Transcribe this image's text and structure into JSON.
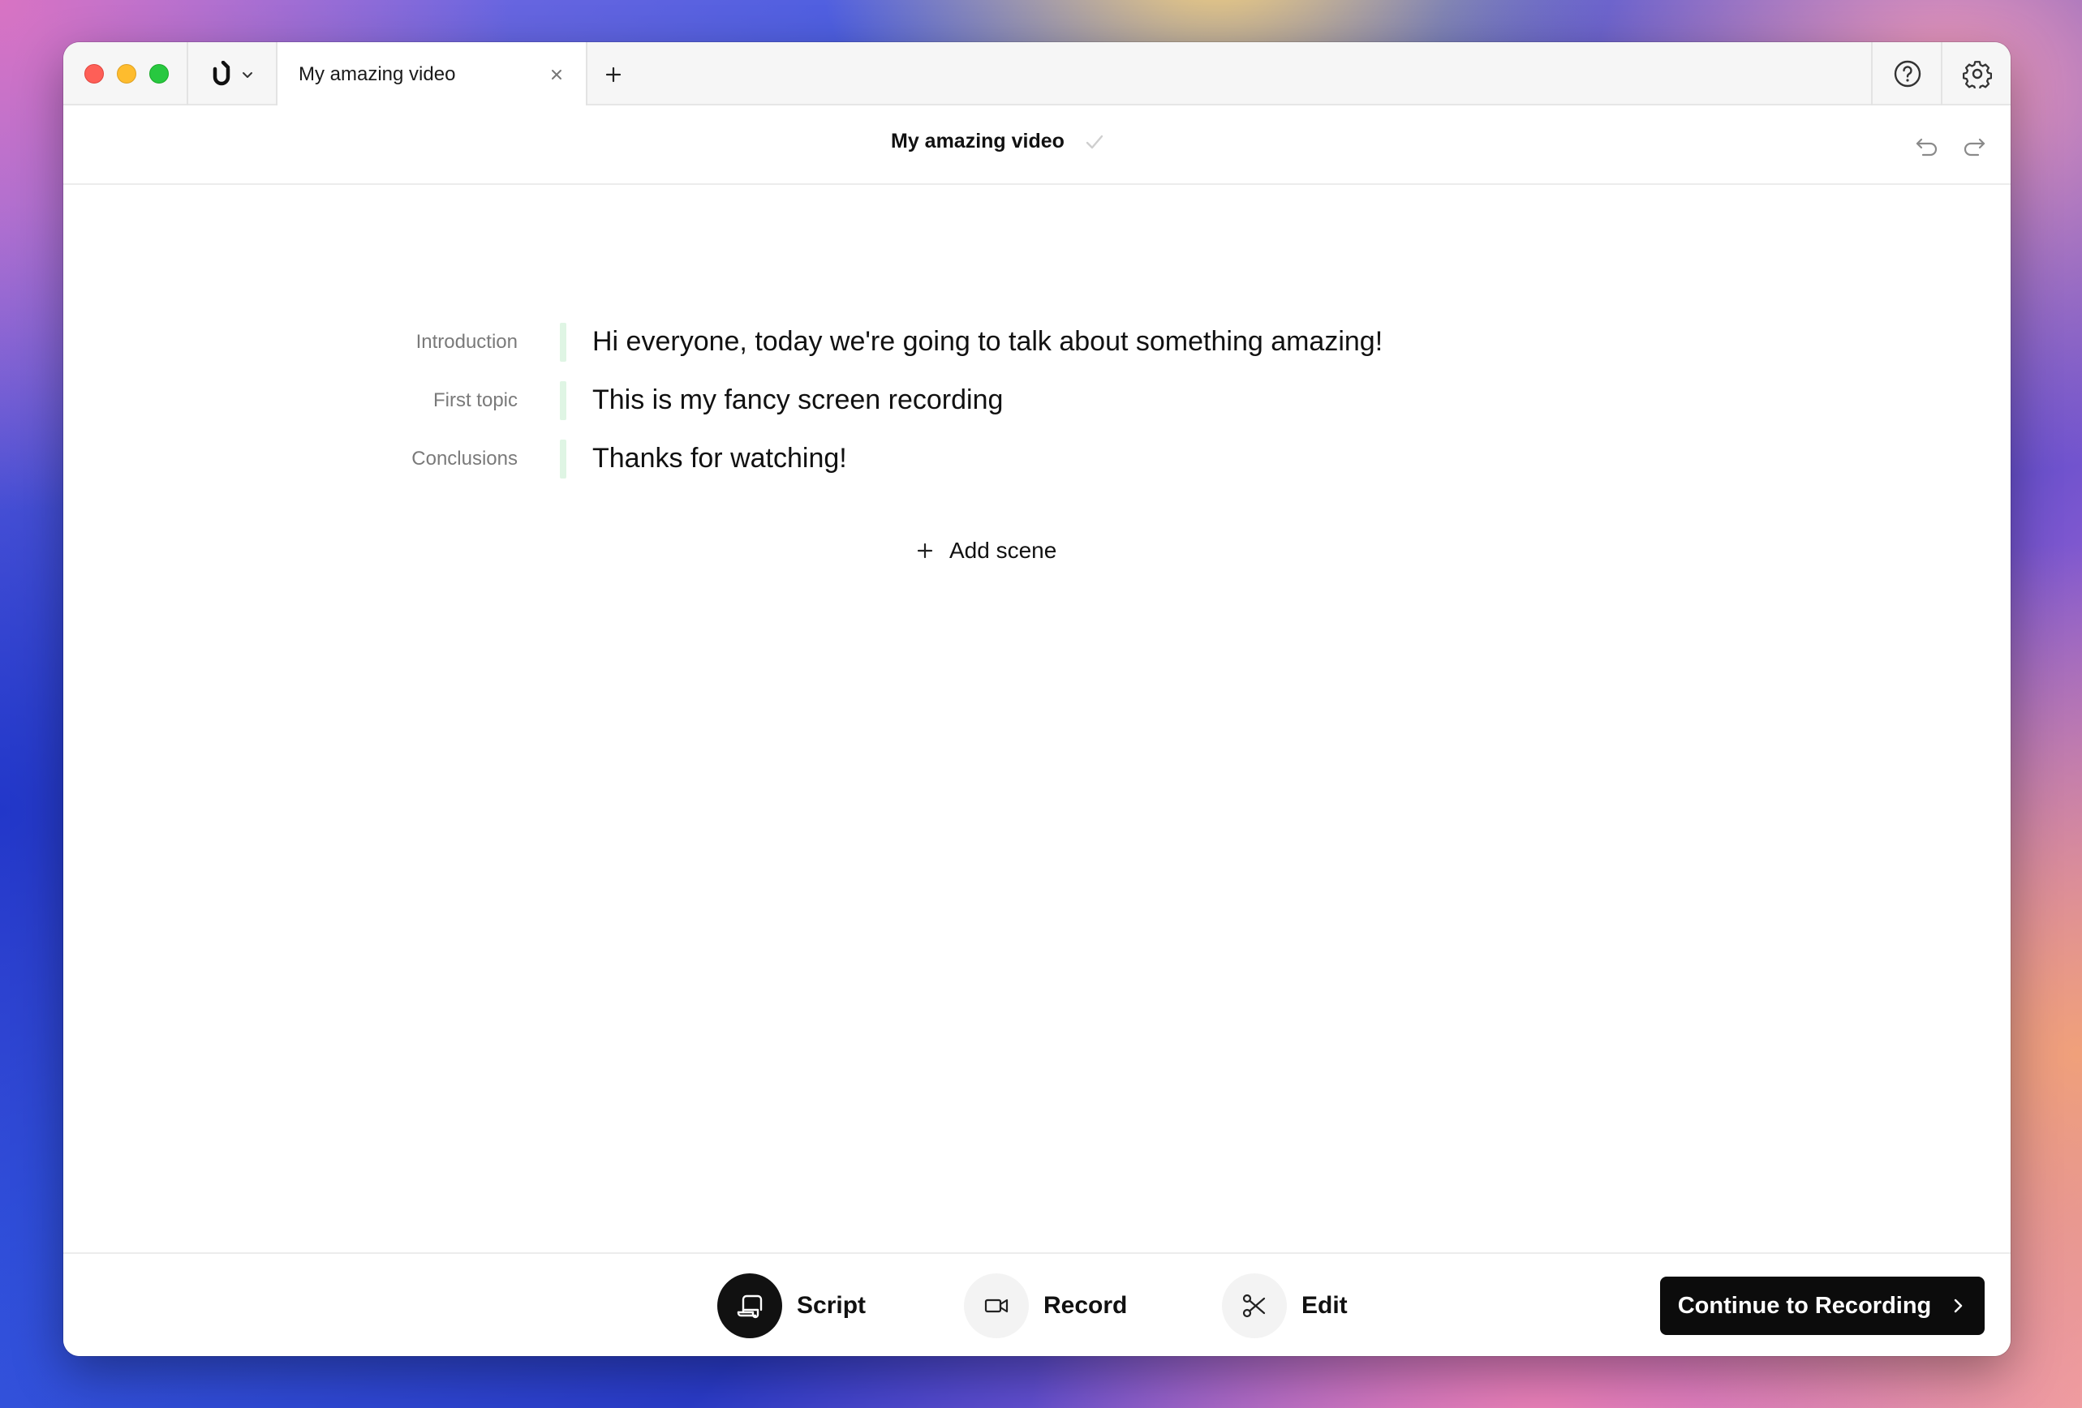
{
  "tabbar": {
    "tab_title": "My amazing video"
  },
  "header": {
    "doc_title": "My amazing video"
  },
  "scenes": [
    {
      "label": "Introduction",
      "text": "Hi everyone, today we're going to talk about something amazing!"
    },
    {
      "label": "First topic",
      "text": "This is my fancy screen recording"
    },
    {
      "label": "Conclusions",
      "text": "Thanks for watching!"
    }
  ],
  "add_scene_label": "Add scene",
  "footer": {
    "steps": [
      {
        "label": "Script",
        "icon": "script-icon",
        "active": true
      },
      {
        "label": "Record",
        "icon": "video-camera-icon",
        "active": false
      },
      {
        "label": "Edit",
        "icon": "scissors-icon",
        "active": false
      }
    ],
    "continue_label": "Continue to Recording"
  },
  "colors": {
    "accent_dark": "#0c0c0c",
    "scene_bar": "#dff5e4",
    "close": "#fe5f57",
    "minimize": "#febc2e",
    "zoom": "#28c840"
  }
}
